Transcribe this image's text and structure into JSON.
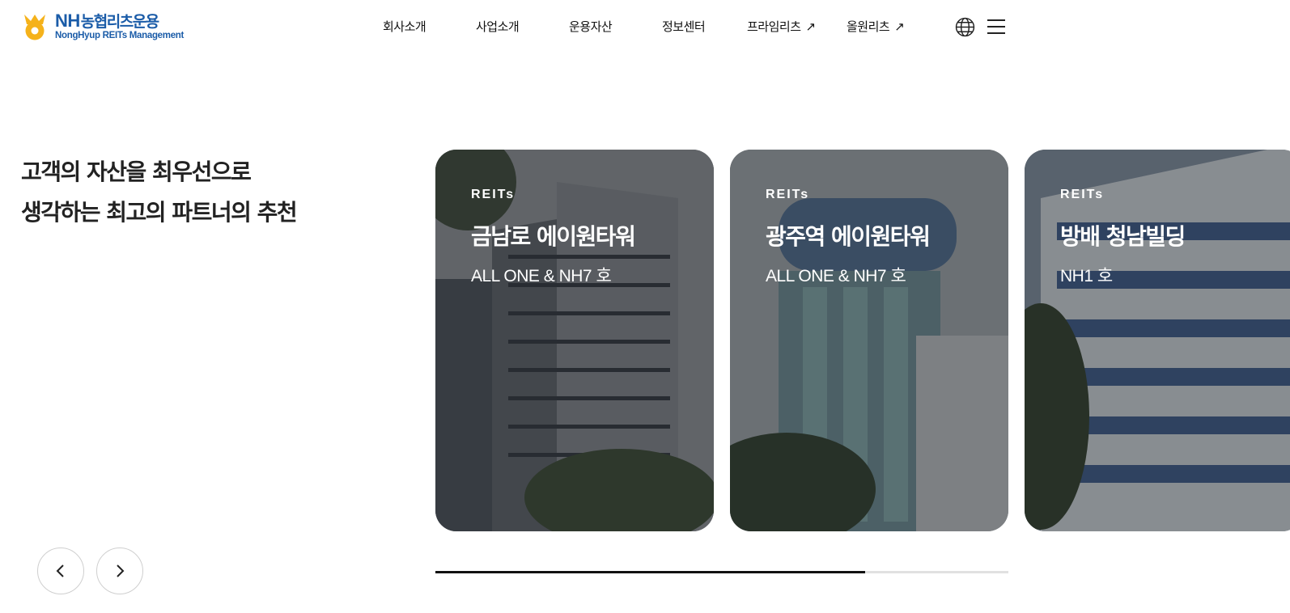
{
  "logo": {
    "nh": "NH",
    "ko": "농협리츠운용",
    "en": "NongHyup REITs Management",
    "colors": {
      "brand_blue": "#1b5ca8",
      "brand_yellow": "#f5b21b"
    }
  },
  "nav": {
    "items": [
      {
        "label": "회사소개",
        "external": false
      },
      {
        "label": "사업소개",
        "external": false
      },
      {
        "label": "운용자산",
        "external": false
      },
      {
        "label": "정보센터",
        "external": false
      },
      {
        "label": "프라임리츠",
        "external": true,
        "arrow": "↗"
      },
      {
        "label": "올원리츠",
        "external": true,
        "arrow": "↗"
      }
    ],
    "icons": {
      "language": "globe-icon",
      "menu": "hamburger-menu-icon"
    }
  },
  "hero": {
    "line1": "고객의 자산을 최우선으로",
    "line2": "생각하는 최고의 파트너의 추천"
  },
  "cards": [
    {
      "tag": "REITs",
      "title": "금남로 에이원타워",
      "subtitle": "ALL ONE & NH7 호"
    },
    {
      "tag": "REITs",
      "title": "광주역 에이원타워",
      "subtitle": "ALL ONE & NH7 호"
    },
    {
      "tag": "REITs",
      "title": "방배 청남빌딩",
      "subtitle": "NH1 호"
    }
  ],
  "slider": {
    "prev_icon": "chevron-left-icon",
    "next_icon": "chevron-right-icon",
    "progress": 0.75
  }
}
